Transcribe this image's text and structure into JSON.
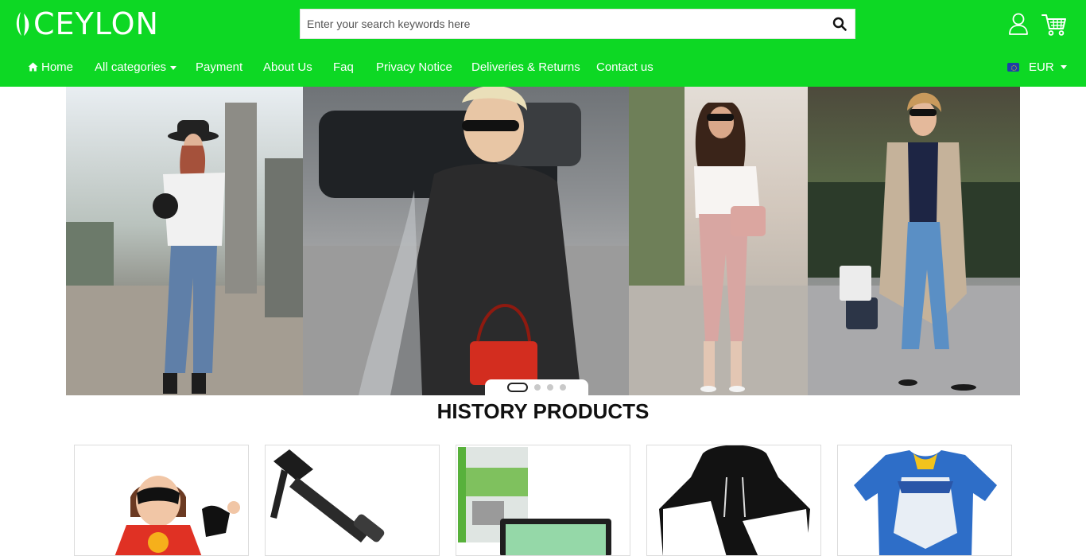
{
  "header": {
    "logo_text": "CEYLON",
    "search": {
      "placeholder": "Enter your search keywords here"
    },
    "icons": [
      "search-icon",
      "user-icon",
      "cart-icon"
    ]
  },
  "nav": {
    "items": [
      {
        "label": "Home",
        "icon": "home-icon"
      },
      {
        "label": "All categories",
        "has_dropdown": true
      },
      {
        "label": "Payment"
      },
      {
        "label": "About Us"
      },
      {
        "label": "Faq"
      },
      {
        "label": "Privacy Notice"
      },
      {
        "label": "Deliveries & Returns"
      },
      {
        "label": "Contact us"
      }
    ],
    "currency": {
      "label": "EUR",
      "flag": "eu-flag-icon"
    }
  },
  "banner": {
    "slides_count": 4,
    "active_slide": 1
  },
  "section": {
    "title": "HISTORY PRODUCTS"
  },
  "colors": {
    "brand_green": "#0dd824",
    "text_dark": "#111111",
    "border": "#dcdcdc"
  }
}
